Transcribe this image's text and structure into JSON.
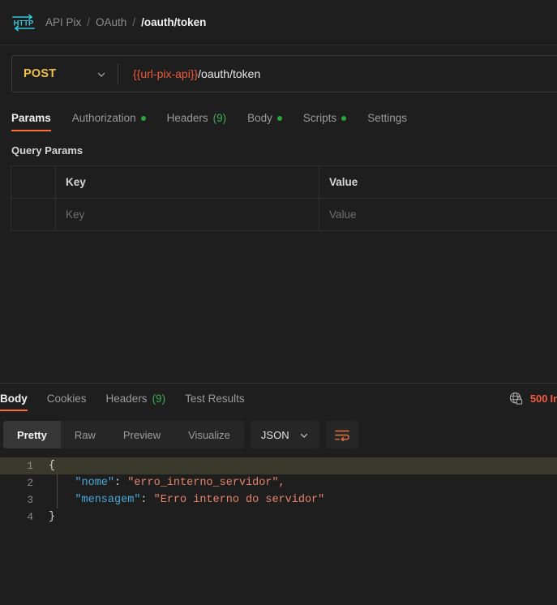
{
  "breadcrumb": {
    "icon": "http-protocol-icon",
    "items": [
      {
        "label": "API Pix",
        "current": false
      },
      {
        "label": "OAuth",
        "current": false
      },
      {
        "label": "/oauth/token",
        "current": true
      }
    ],
    "separator": "/"
  },
  "url_bar": {
    "method": "POST",
    "method_chevron": "chevron-down-icon",
    "url_variable": "{{url-pix-api}}",
    "url_path": "/oauth/token"
  },
  "request_tabs": [
    {
      "label": "Params",
      "active": true,
      "dot": false,
      "count": ""
    },
    {
      "label": "Authorization",
      "active": false,
      "dot": true,
      "count": ""
    },
    {
      "label": "Headers",
      "active": false,
      "dot": false,
      "count": "(9)"
    },
    {
      "label": "Body",
      "active": false,
      "dot": true,
      "count": ""
    },
    {
      "label": "Scripts",
      "active": false,
      "dot": true,
      "count": ""
    },
    {
      "label": "Settings",
      "active": false,
      "dot": false,
      "count": ""
    }
  ],
  "query_params": {
    "title": "Query Params",
    "headers": {
      "key": "Key",
      "value": "Value"
    },
    "rows": [
      {
        "key_placeholder": "Key",
        "value_placeholder": "Value"
      }
    ]
  },
  "response": {
    "tabs": [
      {
        "label": "Body",
        "active": true,
        "count": ""
      },
      {
        "label": "Cookies",
        "active": false,
        "count": ""
      },
      {
        "label": "Headers",
        "active": false,
        "count": "(9)"
      },
      {
        "label": "Test Results",
        "active": false,
        "count": ""
      }
    ],
    "security_icon": "globe-lock-icon",
    "status_code": "500",
    "status_text": "Internal Se",
    "status_color": "#f05b3c",
    "format_tabs": [
      {
        "label": "Pretty",
        "active": true
      },
      {
        "label": "Raw",
        "active": false
      },
      {
        "label": "Preview",
        "active": false
      },
      {
        "label": "Visualize",
        "active": false
      }
    ],
    "language_select": {
      "value": "JSON",
      "chevron": "chevron-down-icon"
    },
    "wrap_button_icon": "word-wrap-icon",
    "body_lines": [
      {
        "number": "1",
        "highlighted": true,
        "segments": [
          {
            "cls": "j-brace",
            "t": "{"
          }
        ]
      },
      {
        "number": "2",
        "highlighted": false,
        "segments": [
          {
            "cls": "j-key",
            "t": "    \"nome\""
          },
          {
            "cls": "j-punc",
            "t": ": "
          },
          {
            "cls": "j-str",
            "t": "\"erro_interno_servidor\","
          }
        ]
      },
      {
        "number": "3",
        "highlighted": false,
        "segments": [
          {
            "cls": "j-key",
            "t": "    \"mensagem\""
          },
          {
            "cls": "j-punc",
            "t": ": "
          },
          {
            "cls": "j-str",
            "t": "\"Erro interno do servidor\""
          }
        ]
      },
      {
        "number": "4",
        "highlighted": false,
        "segments": [
          {
            "cls": "j-brace",
            "t": "}"
          }
        ]
      }
    ]
  },
  "colors": {
    "background": "#1e1e1e",
    "accent_orange": "#ff6c37",
    "method_post": "#f0c040",
    "status_error": "#f05b3c",
    "dot_green": "#29a83a",
    "json_key": "#4aa8d8",
    "json_string": "#e8836a",
    "active_line": "#3a3a2c"
  }
}
